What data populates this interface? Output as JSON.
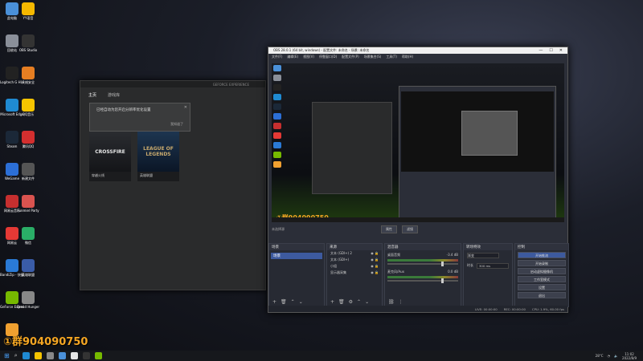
{
  "desktop_icons": [
    {
      "label": "此电脑",
      "color": "#4a90d9"
    },
    {
      "label": "YY语音",
      "color": "#f5b800"
    },
    {
      "label": "回收站",
      "color": "#8a8f99"
    },
    {
      "label": "OBS Studio",
      "color": "#333333"
    },
    {
      "label": "Logitech G HUB",
      "color": "#222222"
    },
    {
      "label": "火绒安全",
      "color": "#e67e22"
    },
    {
      "label": "Microsoft Edge",
      "color": "#1f8ad2"
    },
    {
      "label": "QQ音乐",
      "color": "#f5c400"
    },
    {
      "label": "Steam",
      "color": "#1b2838"
    },
    {
      "label": "腾讯QQ",
      "color": "#d32f2f"
    },
    {
      "label": "WeGame",
      "color": "#2c6fd6"
    },
    {
      "label": "新建文件",
      "color": "#555555"
    },
    {
      "label": "网易云音乐",
      "color": "#c62f2f"
    },
    {
      "label": "Funmiel Party",
      "color": "#d9534f"
    },
    {
      "label": "网易云",
      "color": "#e53935"
    },
    {
      "label": "微信",
      "color": "#2aae67"
    },
    {
      "label": "BandiZip - 快捷方式",
      "color": "#2a7ad6"
    },
    {
      "label": "英雄联盟",
      "color": "#3a5ca8"
    },
    {
      "label": "GeForce Experience",
      "color": "#76b900"
    },
    {
      "label": "Dread Hunger",
      "color": "#888888"
    },
    {
      "label": "",
      "color": "#f0a030"
    }
  ],
  "launcher": {
    "tabs": [
      "主页",
      "游戏库"
    ],
    "dialog_text": "已经自动为您开启分辨率优化设置",
    "dialog_action": "我知道了",
    "games": [
      {
        "art": "CROSSFIRE",
        "name": "穿越火线"
      },
      {
        "art": "LEAGUE OF LEGENDS",
        "name": "英雄联盟"
      }
    ]
  },
  "obs": {
    "title": "OBS 28.0.1 (64 bit, windows) - 配置文件: 未命名 - 场景: 未命名",
    "menu": [
      "文件(F)",
      "编辑(E)",
      "视图(V)",
      "停靠窗口(D)",
      "配置文件(P)",
      "场景集合(S)",
      "工具(T)",
      "帮助(H)"
    ],
    "preview_watermark": "①群904090750",
    "controls_label": "未选择源",
    "controls_buttons": [
      "属性",
      "滤镜"
    ],
    "docks": {
      "scenes": {
        "title": "场景",
        "items": [
          "场景"
        ]
      },
      "sources": {
        "title": "来源",
        "items": [
          "文本 (GDI+) 2",
          "文本 (GDI+)",
          "小组",
          "显示器采集"
        ]
      },
      "mixer": {
        "title": "混音器",
        "tracks": [
          {
            "name": "桌面音频",
            "db": "-3.4 dB"
          },
          {
            "name": "麦克风/Aux",
            "db": "0.0 dB"
          }
        ]
      },
      "transitions": {
        "title": "转场特效",
        "rows": [
          {
            "label": "渐变",
            "value": ""
          },
          {
            "label": "时长",
            "value": "300 ms"
          }
        ]
      },
      "controls": {
        "title": "控制",
        "buttons": [
          "开始推流",
          "开始录制",
          "启动虚拟摄像机",
          "工作室模式",
          "设置",
          "退出"
        ]
      }
    },
    "status": [
      "LIVE: 00:00:00",
      "REC: 00:00:00",
      "CPU: 1.9%, 60.00 fps"
    ]
  },
  "desktop_watermark": "①群904090750",
  "taskbar": {
    "apps": [
      "#1f8ad2",
      "#f5c400",
      "#888888",
      "#4a90d9",
      "#e5e5e5",
      "#333333",
      "#76b900"
    ],
    "weather": "28°C",
    "time": "11:02",
    "date": "2022/8/9"
  }
}
